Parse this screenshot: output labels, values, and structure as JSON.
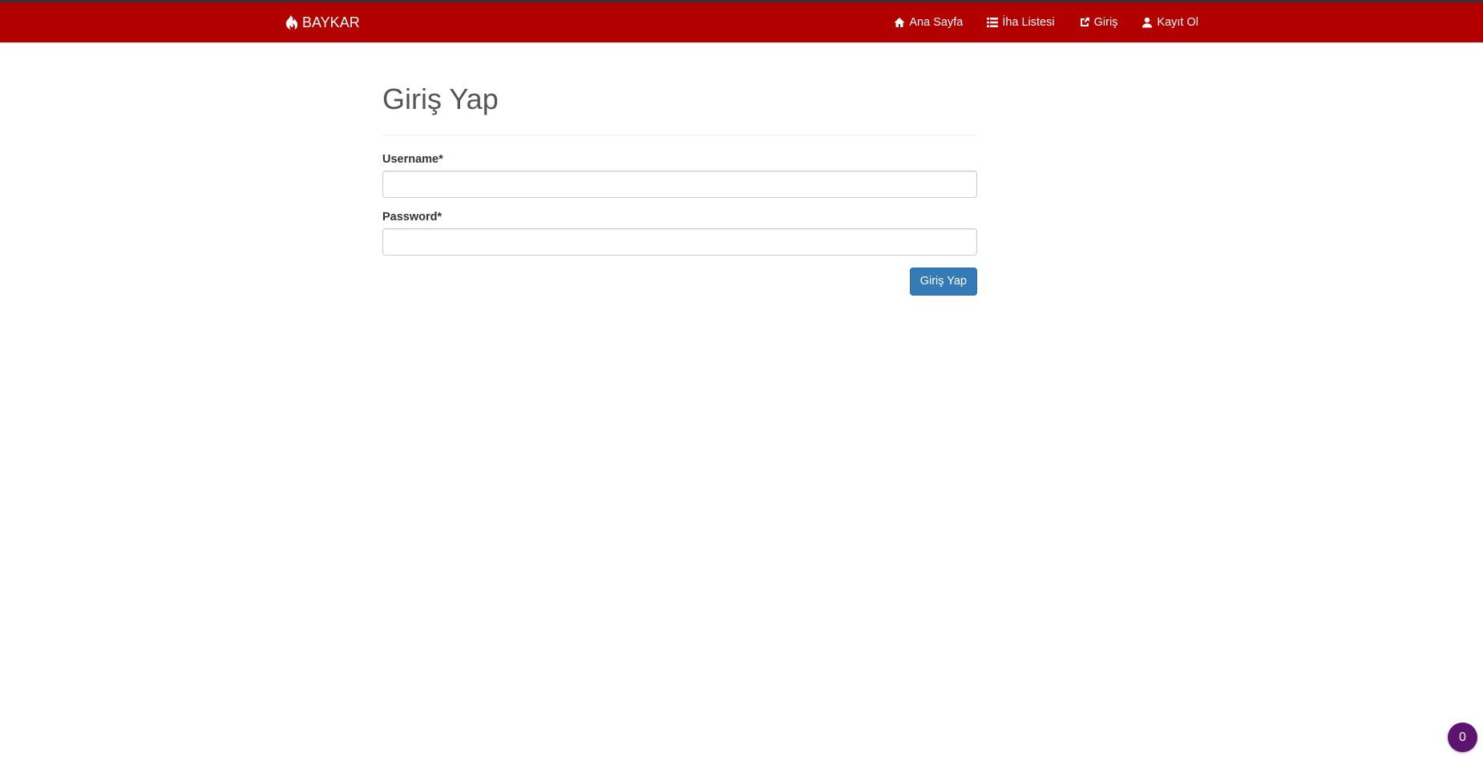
{
  "navbar": {
    "brand_label": "BAYKAR",
    "brand_icon": "fire-icon",
    "background_color": "#b20000",
    "items": [
      {
        "label": "Ana Sayfa",
        "icon": "home-icon"
      },
      {
        "label": "İha Listesi",
        "icon": "list-icon"
      },
      {
        "label": "Giriş",
        "icon": "sign-in-icon"
      },
      {
        "label": "Kayıt Ol",
        "icon": "user-icon"
      }
    ]
  },
  "login_form": {
    "title": "Giriş Yap",
    "username_label": "Username*",
    "username_value": "",
    "password_label": "Password*",
    "password_value": "",
    "submit_label": "Giriş Yap",
    "submit_color": "#337ab7"
  },
  "floating_badge": {
    "value": "0",
    "color": "#5d1470"
  }
}
